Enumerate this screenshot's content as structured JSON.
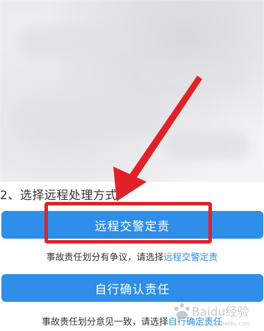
{
  "section": {
    "title": "2、选择远程处理方式"
  },
  "buttons": {
    "remote_label": "远程交警定责",
    "self_label": "自行确认责任"
  },
  "hints": {
    "remote_prefix": "事故责任划分有争议，请选择",
    "remote_link": "远程交警定责",
    "self_prefix": "事故责任划分意见一致，请选择",
    "self_link": "自行确定责任"
  },
  "watermark": {
    "text": "Baidu经验",
    "sub": "jingyan.baidu.com"
  },
  "colors": {
    "primary": "#2e8ee8",
    "annotation": "#e02228"
  }
}
